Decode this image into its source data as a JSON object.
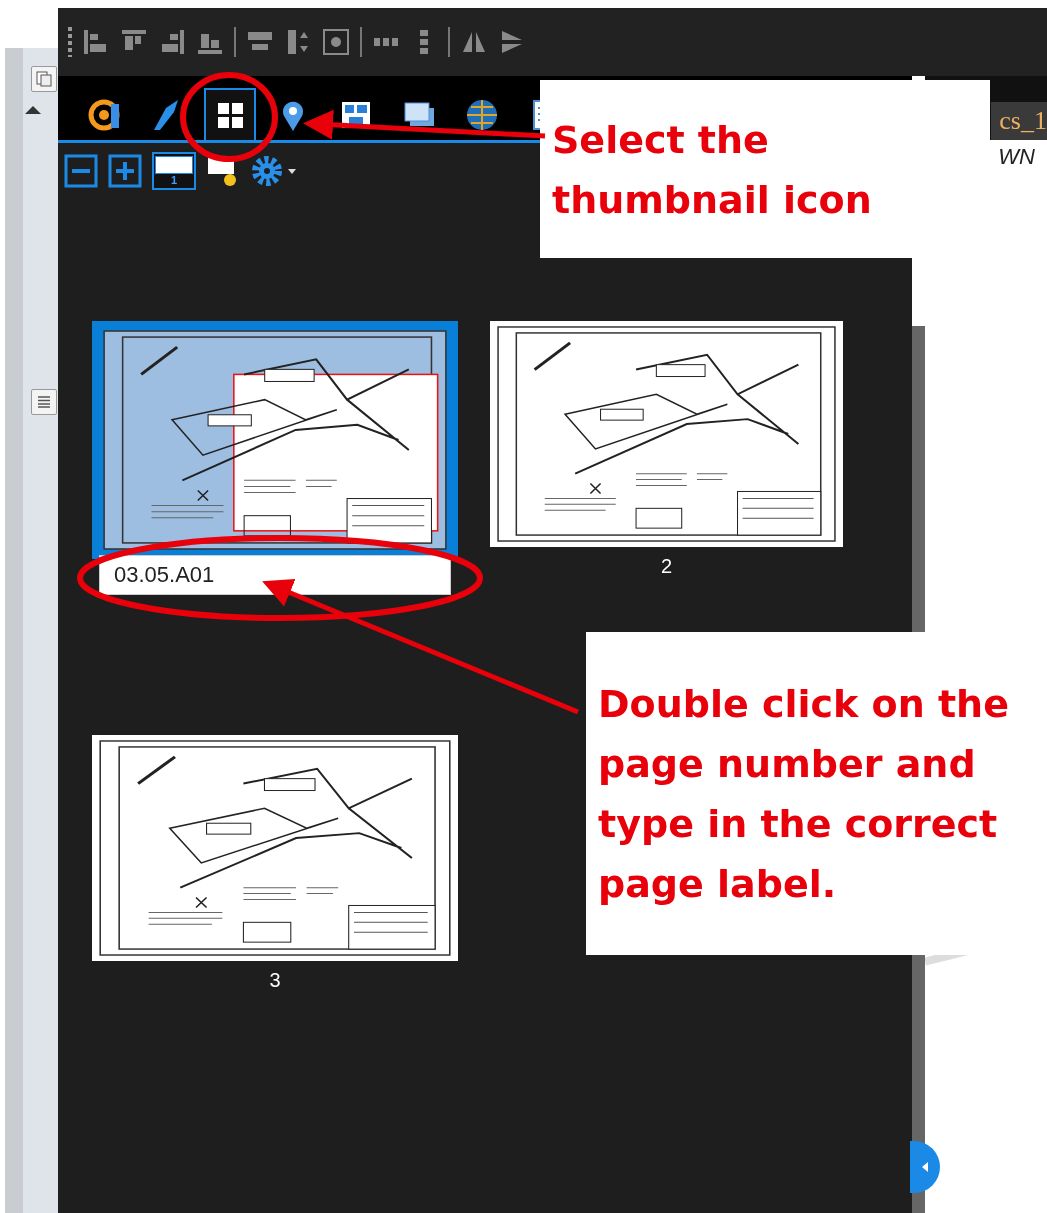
{
  "toolbar": {
    "tools": [
      {
        "kind": "align-left"
      },
      {
        "kind": "align-top"
      },
      {
        "kind": "align-right"
      },
      {
        "kind": "align-bottom"
      },
      {
        "kind": "center-horizontal"
      },
      {
        "kind": "center-vertical"
      },
      {
        "kind": "center"
      },
      {
        "kind": "distribute-horizontal"
      },
      {
        "kind": "distribute-vertical"
      },
      {
        "kind": "flip-horizontal"
      },
      {
        "kind": "flip-vertical"
      }
    ]
  },
  "panel_tabs": [
    {
      "kind": "properties",
      "selected": false
    },
    {
      "kind": "pen",
      "selected": false
    },
    {
      "kind": "thumbnails",
      "selected": true
    },
    {
      "kind": "location",
      "selected": false
    },
    {
      "kind": "blocks",
      "selected": false
    },
    {
      "kind": "layers",
      "selected": false
    },
    {
      "kind": "globe",
      "selected": false
    },
    {
      "kind": "document",
      "selected": false
    }
  ],
  "thumbnail_tools": {
    "page_number": "1"
  },
  "thumbnails": [
    {
      "label": "03.05.A01",
      "selected": true,
      "editing": true
    },
    {
      "label": "2",
      "selected": false,
      "editing": false
    },
    {
      "label": "3",
      "selected": false,
      "editing": false
    }
  ],
  "document_tab": {
    "title": "cs_1",
    "subtitle": "WN"
  },
  "callouts": [
    {
      "text": "Select the thumbnail icon"
    },
    {
      "text": "Double click on the page number and type in the correct page label."
    }
  ]
}
